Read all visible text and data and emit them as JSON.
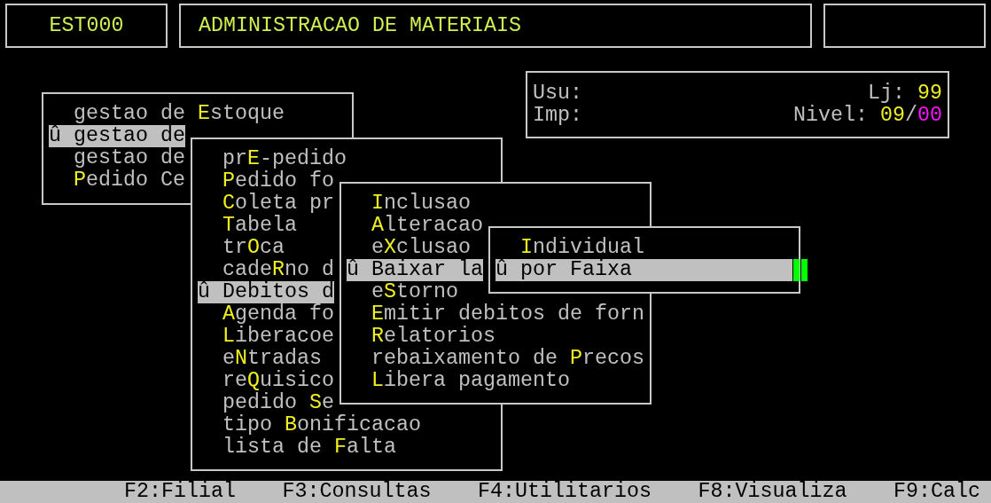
{
  "header": {
    "program_code": "EST000",
    "title": "ADMINISTRACAO DE MATERIAIS"
  },
  "info": {
    "user_label": "Usu:",
    "printer_label": "Imp:",
    "store_label": "Lj:",
    "store": "99",
    "level_label": "Nivel:",
    "level_main": "09",
    "level_separator": "/",
    "level_sub": "00"
  },
  "menus": [
    {
      "items": [
        {
          "pre": "gestao de ",
          "key": "E",
          "post": "stoque",
          "selected": false
        },
        {
          "pre": "û gestao de",
          "selected": true
        },
        {
          "pre": "gestao de",
          "selected": false
        },
        {
          "key": "P",
          "post": "edido Ce",
          "selected": false
        }
      ]
    },
    {
      "items": [
        {
          "pre": "pr",
          "key": "E",
          "post": "-pedido",
          "selected": false
        },
        {
          "key": "P",
          "post": "edido fo",
          "selected": false
        },
        {
          "key": "C",
          "post": "oleta pr",
          "selected": false
        },
        {
          "key": "T",
          "post": "abela",
          "selected": false
        },
        {
          "pre": "tr",
          "key": "O",
          "post": "ca",
          "selected": false
        },
        {
          "pre": "cade",
          "key": "R",
          "post": "no d",
          "selected": false
        },
        {
          "pre": "û Debitos d",
          "selected": true
        },
        {
          "key": "A",
          "post": "genda fo",
          "selected": false
        },
        {
          "key": "L",
          "post": "iberacoe",
          "selected": false
        },
        {
          "pre": "e",
          "key": "N",
          "post": "tradas",
          "selected": false
        },
        {
          "pre": "re",
          "key": "Q",
          "post": "uisico",
          "selected": false
        },
        {
          "pre": "pedido ",
          "key": "S",
          "post": "e",
          "selected": false
        },
        {
          "pre": "tipo ",
          "key": "B",
          "post": "onificacao",
          "selected": false
        },
        {
          "pre": "lista de ",
          "key": "F",
          "post": "alta",
          "selected": false
        }
      ]
    },
    {
      "items": [
        {
          "key": "I",
          "post": "nclusao",
          "selected": false
        },
        {
          "key": "A",
          "post": "lteracao",
          "selected": false
        },
        {
          "pre": "e",
          "key": "X",
          "post": "clusao",
          "selected": false
        },
        {
          "pre": "û Baixar la",
          "selected": true
        },
        {
          "pre": "e",
          "key": "S",
          "post": "torno",
          "selected": false
        },
        {
          "key": "E",
          "post": "mitir debitos de forn",
          "selected": false
        },
        {
          "key": "R",
          "post": "elatorios",
          "selected": false
        },
        {
          "pre": "rebaixamento de ",
          "key": "P",
          "post": "recos",
          "selected": false
        },
        {
          "key": "L",
          "post": "ibera pagamento",
          "selected": false
        }
      ]
    },
    {
      "items": [
        {
          "key": "I",
          "post": "ndividual",
          "selected": false
        },
        {
          "pre": "û por Faixa",
          "selected": true
        }
      ]
    }
  ],
  "function_keys": [
    "F2:Filial",
    "F3:Consultas",
    "F4:Utilitarios",
    "F8:Visualiza",
    "F9:Calc"
  ]
}
